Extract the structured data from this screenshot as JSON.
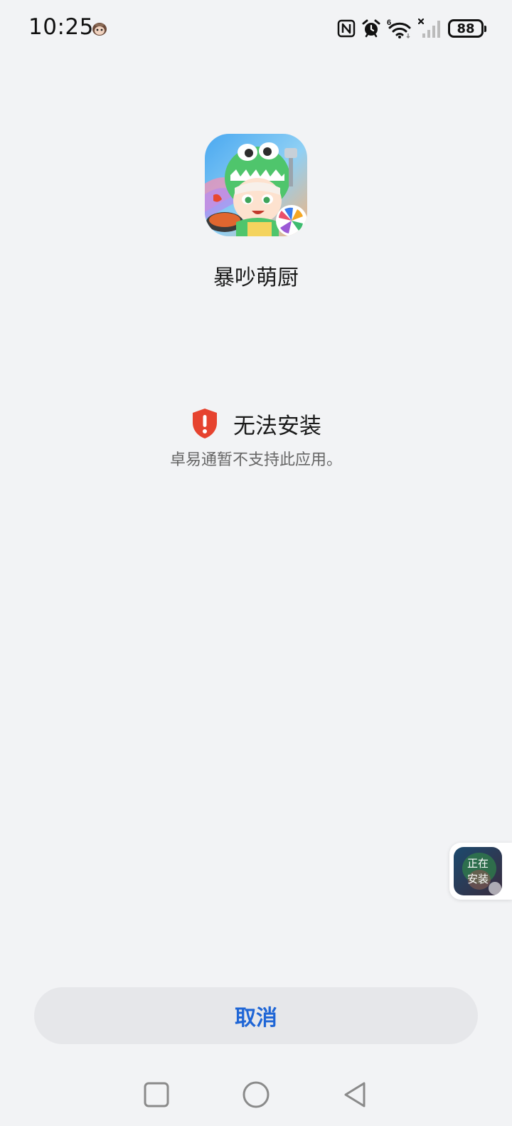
{
  "status_bar": {
    "time": "10:25",
    "battery_level": "88",
    "icons": [
      "notification-app-icon",
      "nfc-icon",
      "alarm-icon",
      "wifi-6-icon",
      "signal-no-sim-icon",
      "battery-icon"
    ]
  },
  "app": {
    "name": "暴吵萌厨",
    "icon": "app-icon-dino-chef"
  },
  "install_error": {
    "title": "无法安装",
    "description": "卓易通暂不支持此应用。",
    "icon": "shield-warning-icon",
    "icon_color": "#e6432f"
  },
  "floating_widget": {
    "label": "正在\n安装"
  },
  "actions": {
    "cancel_label": "取消",
    "cancel_color": "#1f66d6"
  },
  "navigation": {
    "recent": "recent-apps-icon",
    "home": "home-icon",
    "back": "back-icon"
  }
}
